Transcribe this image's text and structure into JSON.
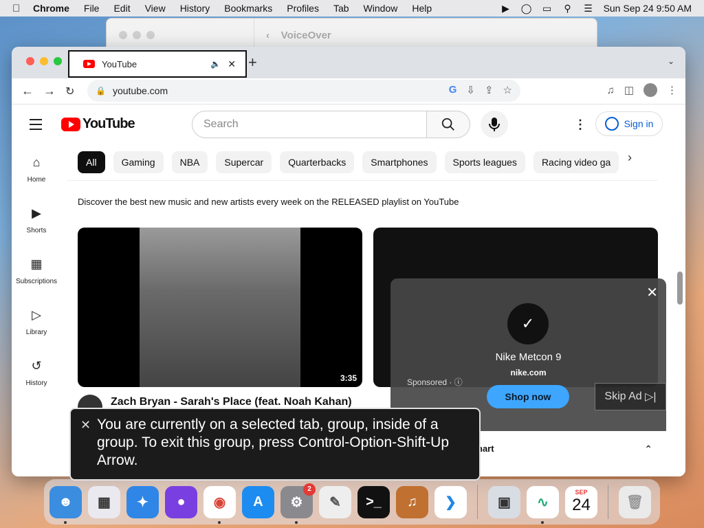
{
  "menubar": {
    "app": "Chrome",
    "items": [
      "File",
      "Edit",
      "View",
      "History",
      "Bookmarks",
      "Profiles",
      "Tab",
      "Window",
      "Help"
    ],
    "clock": "Sun Sep 24  9:50 AM"
  },
  "voiceover_window": {
    "title": "VoiceOver"
  },
  "browser": {
    "tab_title": "YouTube",
    "url": "youtube.com"
  },
  "youtube": {
    "logo": "YouTube",
    "search_placeholder": "Search",
    "signin": "Sign in",
    "nav": [
      {
        "label": "Home",
        "icon": "home-icon"
      },
      {
        "label": "Shorts",
        "icon": "shorts-icon"
      },
      {
        "label": "Subscriptions",
        "icon": "subscriptions-icon"
      },
      {
        "label": "Library",
        "icon": "library-icon"
      },
      {
        "label": "History",
        "icon": "history-icon"
      }
    ],
    "chips": [
      "All",
      "Gaming",
      "NBA",
      "Supercar",
      "Quarterbacks",
      "Smartphones",
      "Sports leagues",
      "Racing video ga"
    ],
    "description": "Discover the best new music and new artists every week on the RELEASED playlist on YouTube",
    "video1": {
      "duration": "3:35",
      "title": "Zach Bryan - Sarah's Place (feat. Noah Kahan)"
    },
    "ad": {
      "name": "Nike Metcon 9",
      "site": "nike.com",
      "sponsored": "Sponsored · ⓘ",
      "shop": "Shop now",
      "skip": "Skip Ad",
      "bottom_label": "nart"
    }
  },
  "voiceover_caption": "You are currently on a selected tab, group, inside of a group.  To exit this group, press Control-Option-Shift-Up Arrow.",
  "dock": {
    "settings_badge": "2",
    "calendar_month": "SEP",
    "calendar_day": "24"
  }
}
